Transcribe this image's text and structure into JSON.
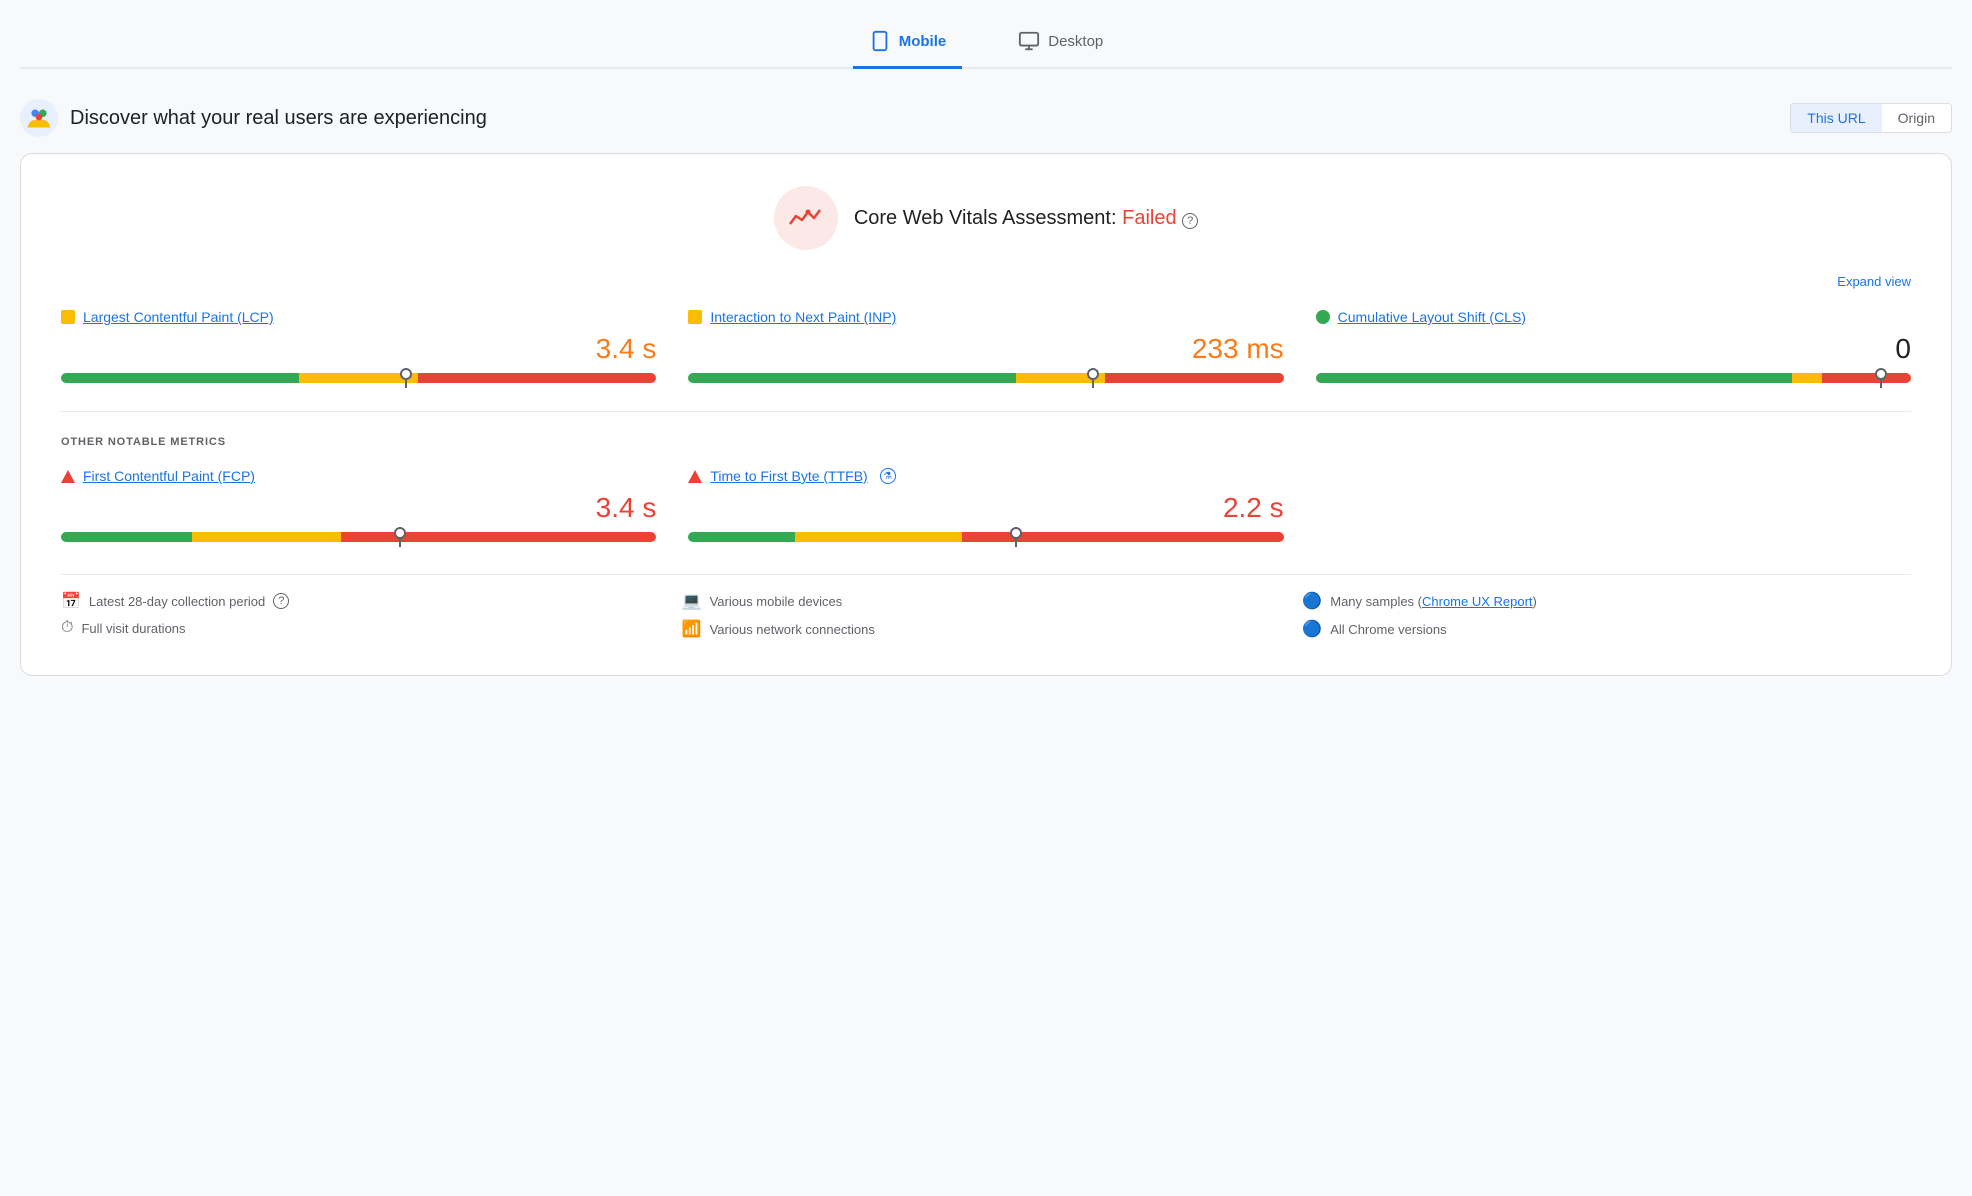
{
  "tabs": [
    {
      "id": "mobile",
      "label": "Mobile",
      "active": true
    },
    {
      "id": "desktop",
      "label": "Desktop",
      "active": false
    }
  ],
  "header": {
    "title": "Discover what your real users are experiencing",
    "url_button": "This URL",
    "origin_button": "Origin"
  },
  "cwv": {
    "assessment_label": "Core Web Vitals Assessment:",
    "assessment_status": "Failed",
    "expand_label": "Expand view",
    "help_char": "?"
  },
  "metrics": [
    {
      "id": "lcp",
      "name": "Largest Contentful Paint (LCP)",
      "value": "3.4 s",
      "value_color": "orange",
      "dot_type": "orange",
      "bar": {
        "green": 40,
        "orange": 20,
        "red": 40,
        "needle_pct": 58
      }
    },
    {
      "id": "inp",
      "name": "Interaction to Next Paint (INP)",
      "value": "233 ms",
      "value_color": "orange",
      "dot_type": "orange",
      "bar": {
        "green": 55,
        "orange": 15,
        "red": 30,
        "needle_pct": 68
      }
    },
    {
      "id": "cls",
      "name": "Cumulative Layout Shift (CLS)",
      "value": "0",
      "value_color": "neutral",
      "dot_type": "green",
      "bar": {
        "green": 80,
        "orange": 5,
        "red": 15,
        "needle_pct": 95
      }
    }
  ],
  "other_metrics_label": "OTHER NOTABLE METRICS",
  "other_metrics": [
    {
      "id": "fcp",
      "name": "First Contentful Paint (FCP)",
      "value": "3.4 s",
      "value_color": "red",
      "dot_type": "triangle-red",
      "bar": {
        "green": 22,
        "orange": 25,
        "red": 53,
        "needle_pct": 57
      }
    },
    {
      "id": "ttfb",
      "name": "Time to First Byte (TTFB)",
      "value": "2.2 s",
      "value_color": "red",
      "dot_type": "triangle-red",
      "show_flask": true,
      "bar": {
        "green": 18,
        "orange": 28,
        "red": 54,
        "needle_pct": 55
      }
    }
  ],
  "footer": {
    "col1": [
      {
        "icon": "📅",
        "text": "Latest 28-day collection period",
        "has_help": true
      },
      {
        "icon": "⏱",
        "text": "Full visit durations"
      }
    ],
    "col2": [
      {
        "icon": "💻",
        "text": "Various mobile devices"
      },
      {
        "icon": "📶",
        "text": "Various network connections"
      }
    ],
    "col3": [
      {
        "icon": "🔵",
        "text": "Many samples",
        "link_text": "Chrome UX Report",
        "link": true
      },
      {
        "icon": "🔵",
        "text": "All Chrome versions"
      }
    ]
  }
}
